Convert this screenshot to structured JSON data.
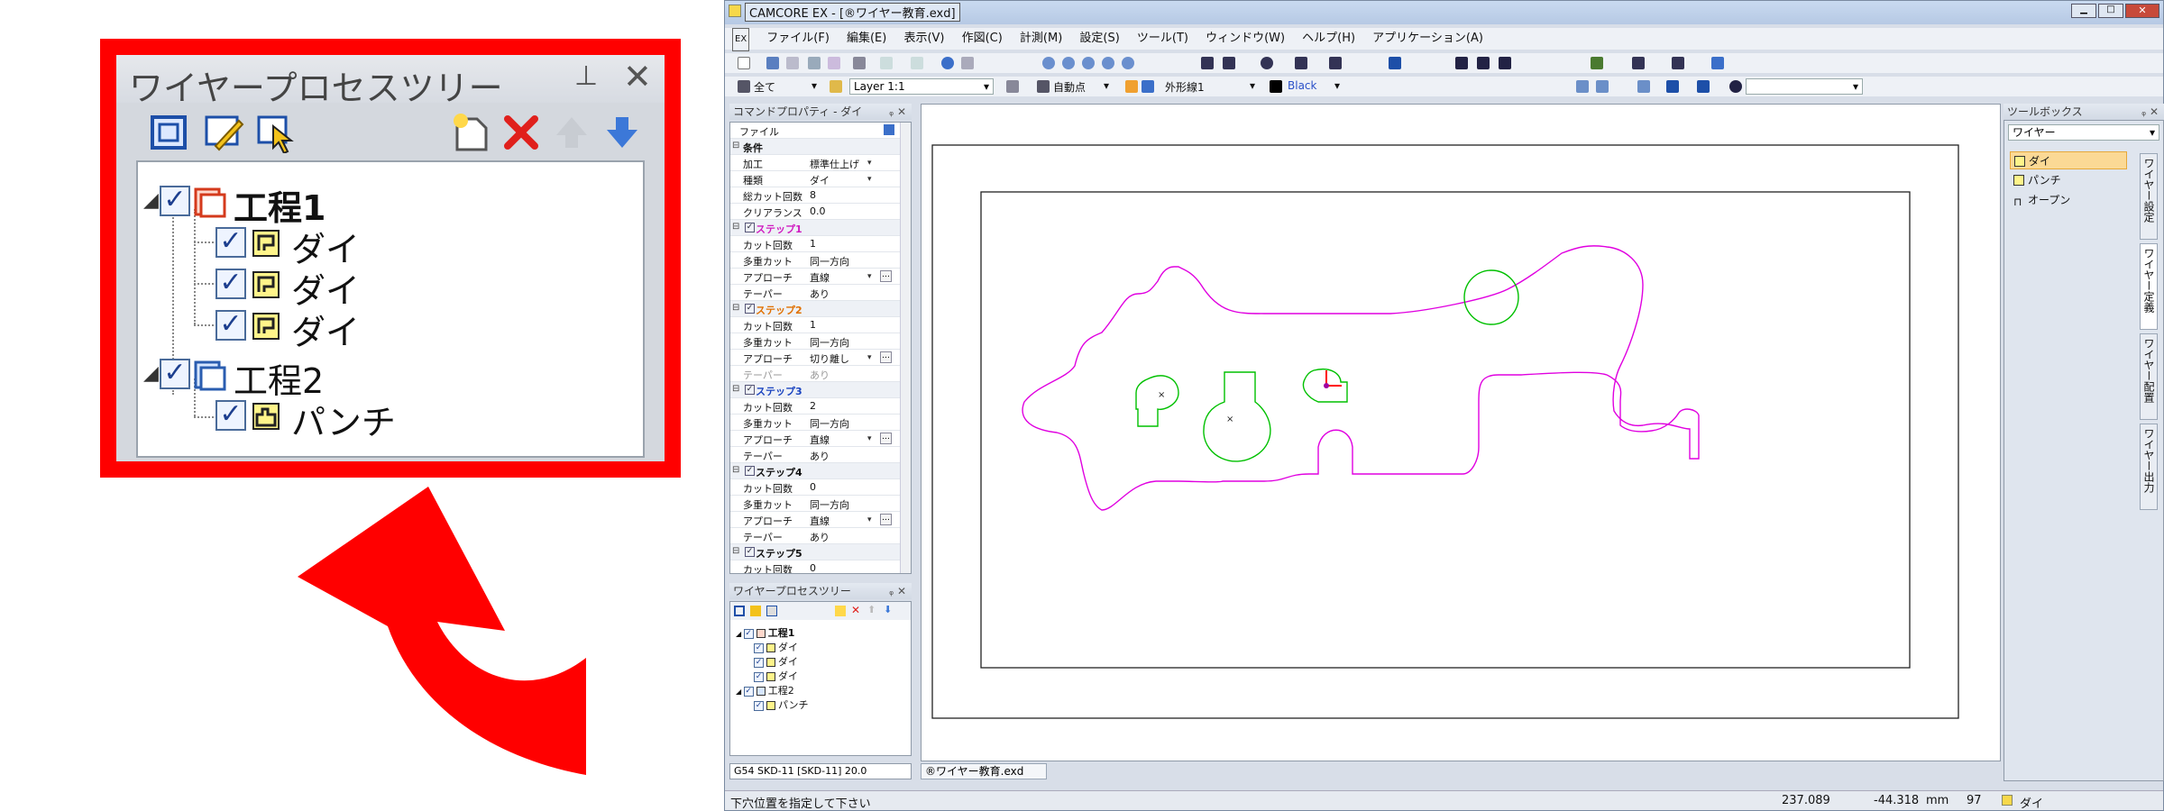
{
  "zoom_panel": {
    "title": "ワイヤープロセスツリー",
    "tree": [
      {
        "label": "工程1",
        "bold": true,
        "children": [
          "ダイ",
          "ダイ",
          "ダイ"
        ]
      },
      {
        "label": "工程2",
        "bold": false,
        "children": [
          "パンチ"
        ]
      }
    ]
  },
  "app": {
    "title": "CAMCORE EX - [®ワイヤー教育.exd]",
    "menu": [
      "ファイル(F)",
      "編集(E)",
      "表示(V)",
      "作図(C)",
      "計測(M)",
      "設定(S)",
      "ツール(T)",
      "ウィンドウ(W)",
      "ヘルプ(H)",
      "アプリケーション(A)"
    ],
    "toolbar2": {
      "filter": "全て",
      "layer": "Layer 1:1",
      "snap": "自動点",
      "linetype": "外形線1",
      "color_name": "Black"
    }
  },
  "props_panel": {
    "title": "コマンドプロパティ - ダイ",
    "file_label": "ファイル",
    "rows": [
      {
        "type": "group",
        "label": "条件"
      },
      {
        "k": "加工",
        "v": "標準仕上げ",
        "dd": true
      },
      {
        "k": "種類",
        "v": "ダイ",
        "dd": true
      },
      {
        "k": "総カット回数",
        "v": "8"
      },
      {
        "k": "クリアランス",
        "v": "0.0"
      },
      {
        "type": "step",
        "label": "ステップ1",
        "color": "#d01cc0"
      },
      {
        "k": "カット回数",
        "v": "1"
      },
      {
        "k": "多重カット",
        "v": "同一方向"
      },
      {
        "k": "アプローチ",
        "v": "直線",
        "dd": true,
        "ell": true
      },
      {
        "k": "テーパー",
        "v": "あり"
      },
      {
        "type": "step",
        "label": "ステップ2",
        "color": "#e07000"
      },
      {
        "k": "カット回数",
        "v": "1"
      },
      {
        "k": "多重カット",
        "v": "同一方向"
      },
      {
        "k": "アプローチ",
        "v": "切り離し",
        "dd": true,
        "ell": true
      },
      {
        "k": "テーパー",
        "v": "あり",
        "dim": true
      },
      {
        "type": "step",
        "label": "ステップ3",
        "color": "#1a44c0"
      },
      {
        "k": "カット回数",
        "v": "2"
      },
      {
        "k": "多重カット",
        "v": "同一方向"
      },
      {
        "k": "アプローチ",
        "v": "直線",
        "dd": true,
        "ell": true
      },
      {
        "k": "テーパー",
        "v": "あり"
      },
      {
        "type": "step",
        "label": "ステップ4",
        "color": "#111111"
      },
      {
        "k": "カット回数",
        "v": "0"
      },
      {
        "k": "多重カット",
        "v": "同一方向"
      },
      {
        "k": "アプローチ",
        "v": "直線",
        "dd": true,
        "ell": true
      },
      {
        "k": "テーパー",
        "v": "あり"
      },
      {
        "type": "step",
        "label": "ステップ5",
        "color": "#111111"
      },
      {
        "k": "カット回数",
        "v": "0"
      }
    ]
  },
  "tree_panel": {
    "title": "ワイヤープロセスツリー",
    "items": [
      {
        "label": "工程1",
        "level": 0,
        "bold": true
      },
      {
        "label": "ダイ",
        "level": 1
      },
      {
        "label": "ダイ",
        "level": 1
      },
      {
        "label": "ダイ",
        "level": 1
      },
      {
        "label": "工程2",
        "level": 0
      },
      {
        "label": "パンチ",
        "level": 1
      }
    ]
  },
  "left_status": "G54  SKD-11 [SKD-11]  20.0",
  "doc_tab": "®ワイヤー教育.exd",
  "toolbox": {
    "title": "ツールボックス",
    "combo": "ワイヤー",
    "items": [
      "ダイ",
      "パンチ",
      "オープン"
    ],
    "vtabs": [
      "ワイヤー設定",
      "ワイヤー定義",
      "ワイヤー配置",
      "ワイヤー出力"
    ]
  },
  "status": {
    "message": "下穴位置を指定して下さい",
    "x": "237.089",
    "y": "-44.318",
    "unit": "mm",
    "num": "97",
    "mode": "ダイ"
  },
  "colors": {
    "callout": "#ff0000",
    "path": "#e000e0",
    "hole": "#00c000",
    "accent_arrow": "#ff0000"
  }
}
